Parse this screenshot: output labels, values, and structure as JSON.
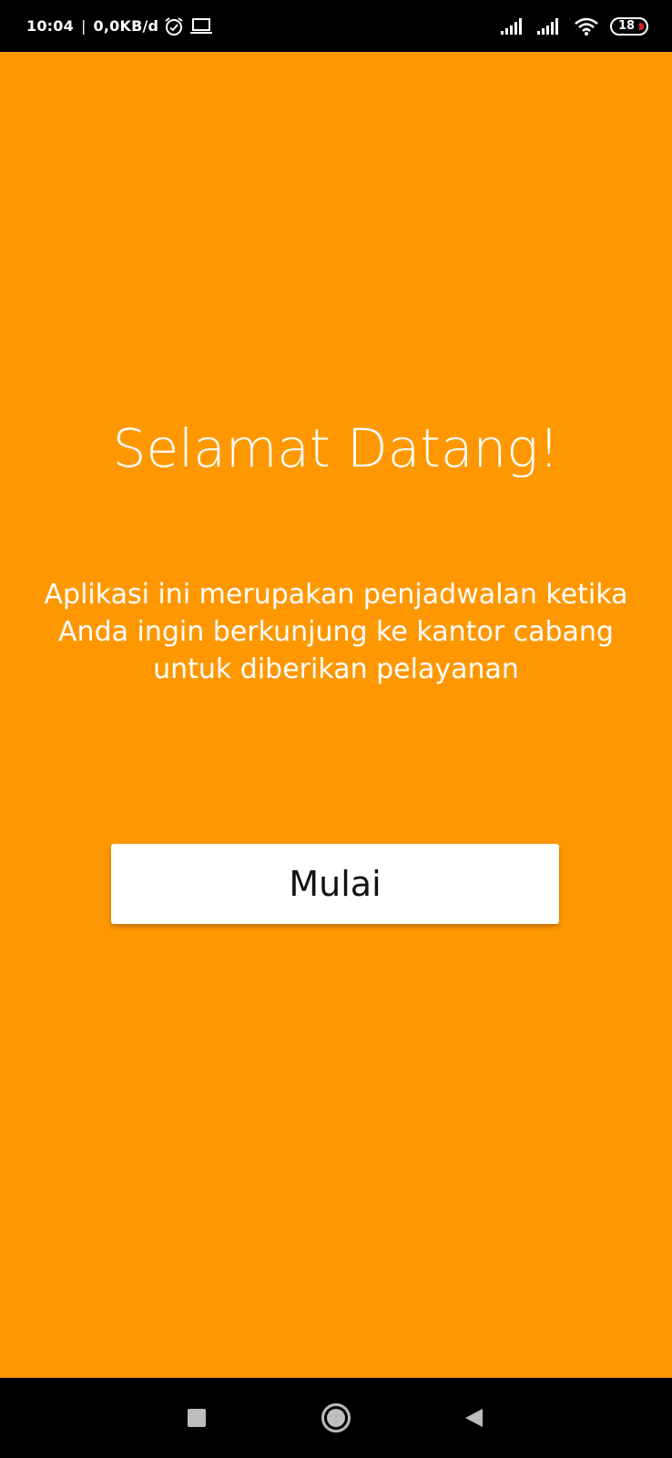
{
  "status_bar": {
    "time": "10:04",
    "separator": "|",
    "network_speed": "0,0KB/d",
    "battery_level": "18",
    "icons": [
      "alarm-icon",
      "laptop-icon",
      "signal-icon",
      "signal-icon",
      "wifi-icon",
      "battery-icon"
    ]
  },
  "welcome": {
    "title": "Selamat Datang!",
    "description": "Aplikasi ini merupakan penjadwalan ketika Anda ingin berkunjung ke kantor cabang untuk diberikan pelayanan",
    "start_button_label": "Mulai"
  },
  "nav_bar": {
    "icons": [
      "recents-square-icon",
      "home-circle-icon",
      "back-triangle-icon"
    ]
  },
  "colors": {
    "background": "#FF9800",
    "button": "#FFFFFF",
    "text": "#FFFFFF",
    "button_text": "#111111",
    "bars": "#000000",
    "battery_low": "#E02020"
  }
}
